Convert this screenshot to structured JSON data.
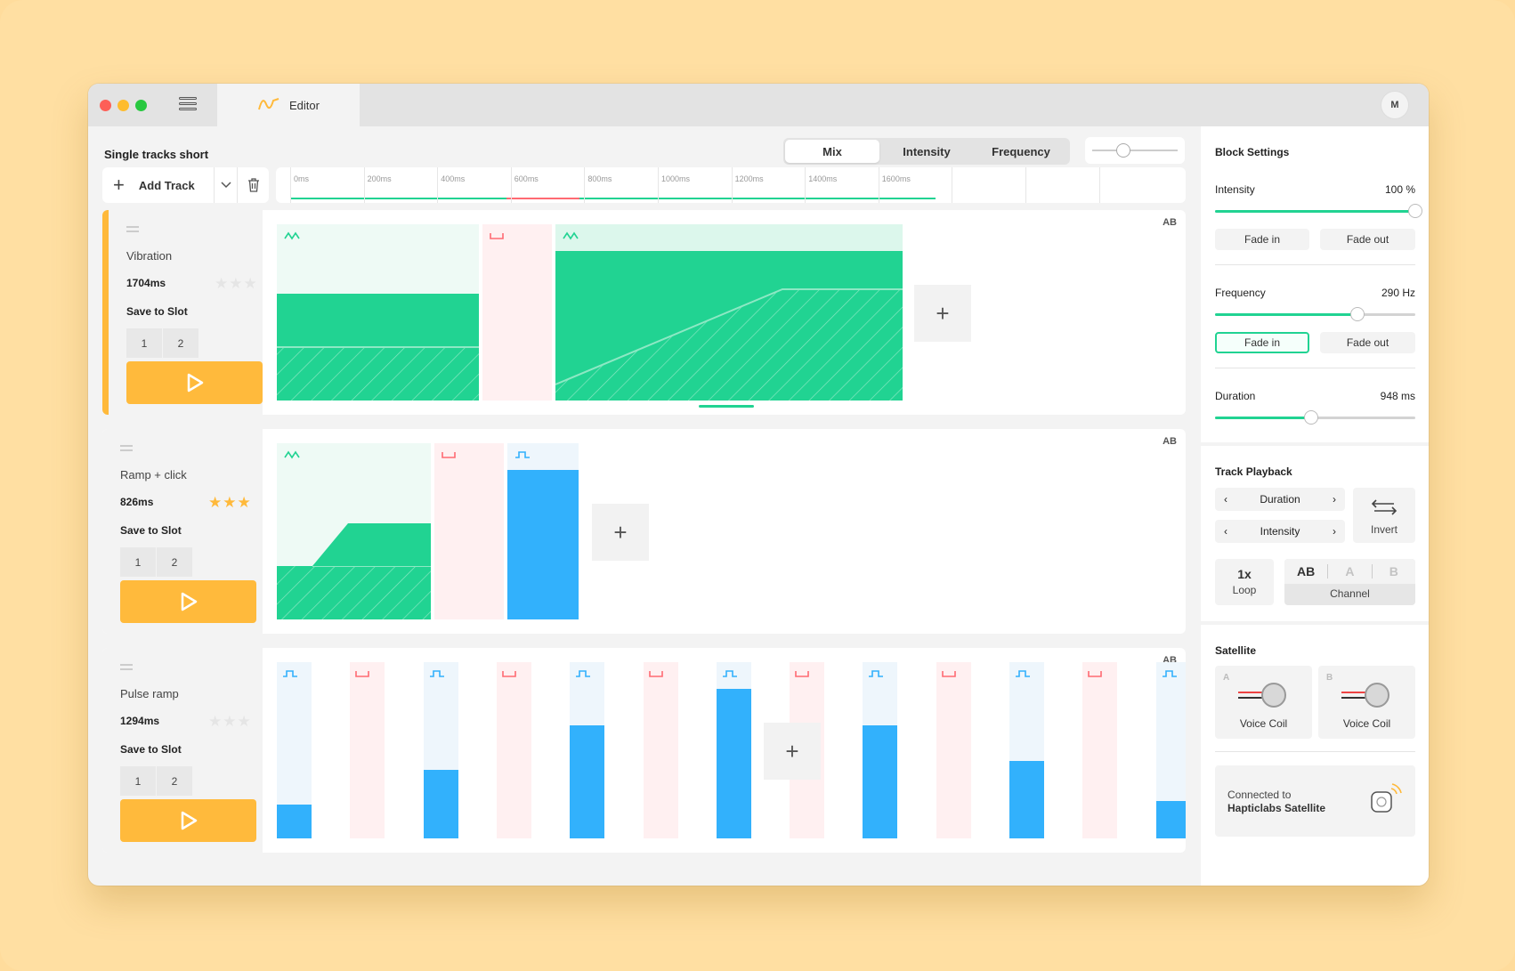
{
  "window": {
    "tab_title": "Editor",
    "avatar_initial": "M"
  },
  "editor": {
    "project_title": "Single tracks short",
    "view_modes": [
      "Mix",
      "Intensity",
      "Frequency"
    ],
    "active_view": "Mix",
    "add_track_label": "Add Track",
    "ruler_ticks": [
      "0ms",
      "200ms",
      "400ms",
      "600ms",
      "800ms",
      "1000ms",
      "1200ms",
      "1400ms",
      "1600ms"
    ]
  },
  "tracks": [
    {
      "name": "Vibration",
      "duration": "1704ms",
      "rating": 0,
      "save_label": "Save to Slot",
      "slots": [
        "1",
        "2"
      ],
      "channel": "AB",
      "active": true,
      "blocks": [
        "vibration",
        "pause",
        "vibration"
      ]
    },
    {
      "name": "Ramp + click",
      "duration": "826ms",
      "rating": 3,
      "save_label": "Save to Slot",
      "slots": [
        "1",
        "2"
      ],
      "channel": "AB",
      "active": false,
      "blocks": [
        "vibration",
        "pause",
        "click"
      ]
    },
    {
      "name": "Pulse ramp",
      "duration": "1294ms",
      "rating": 0,
      "save_label": "Save to Slot",
      "slots": [
        "1",
        "2"
      ],
      "channel": "AB",
      "active": false,
      "blocks": [
        "click",
        "pause",
        "click",
        "pause",
        "click",
        "pause",
        "click",
        "pause",
        "click",
        "pause",
        "click",
        "pause",
        "click"
      ],
      "click_levels": [
        0.19,
        0.39,
        0.64,
        0.85,
        0.64,
        0.44,
        0.21
      ]
    }
  ],
  "block_settings": {
    "title": "Block Settings",
    "intensity": {
      "label": "Intensity",
      "value": "100 %",
      "level": 1.0
    },
    "frequency": {
      "label": "Frequency",
      "value": "290 Hz",
      "level": 0.71
    },
    "duration": {
      "label": "Duration",
      "value": "948 ms",
      "level": 0.48
    },
    "fade_in": "Fade in",
    "fade_out": "Fade out"
  },
  "track_playback": {
    "title": "Track Playback",
    "duration_label": "Duration",
    "intensity_label": "Intensity",
    "invert_label": "Invert",
    "loop_value": "1x",
    "loop_label": "Loop",
    "channel_options": [
      "AB",
      "A",
      "B"
    ],
    "channel_selected": "AB",
    "channel_label": "Channel"
  },
  "satellite": {
    "title": "Satellite",
    "coils": [
      {
        "key": "A",
        "label": "Voice Coil"
      },
      {
        "key": "B",
        "label": "Voice Coil"
      }
    ],
    "connected_prefix": "Connected to",
    "device_name": "Hapticlabs Satellite"
  },
  "colors": {
    "vibration": "#21d392",
    "pause": "#ff6a72",
    "click": "#32b1fc",
    "accent": "#ffba3c"
  }
}
